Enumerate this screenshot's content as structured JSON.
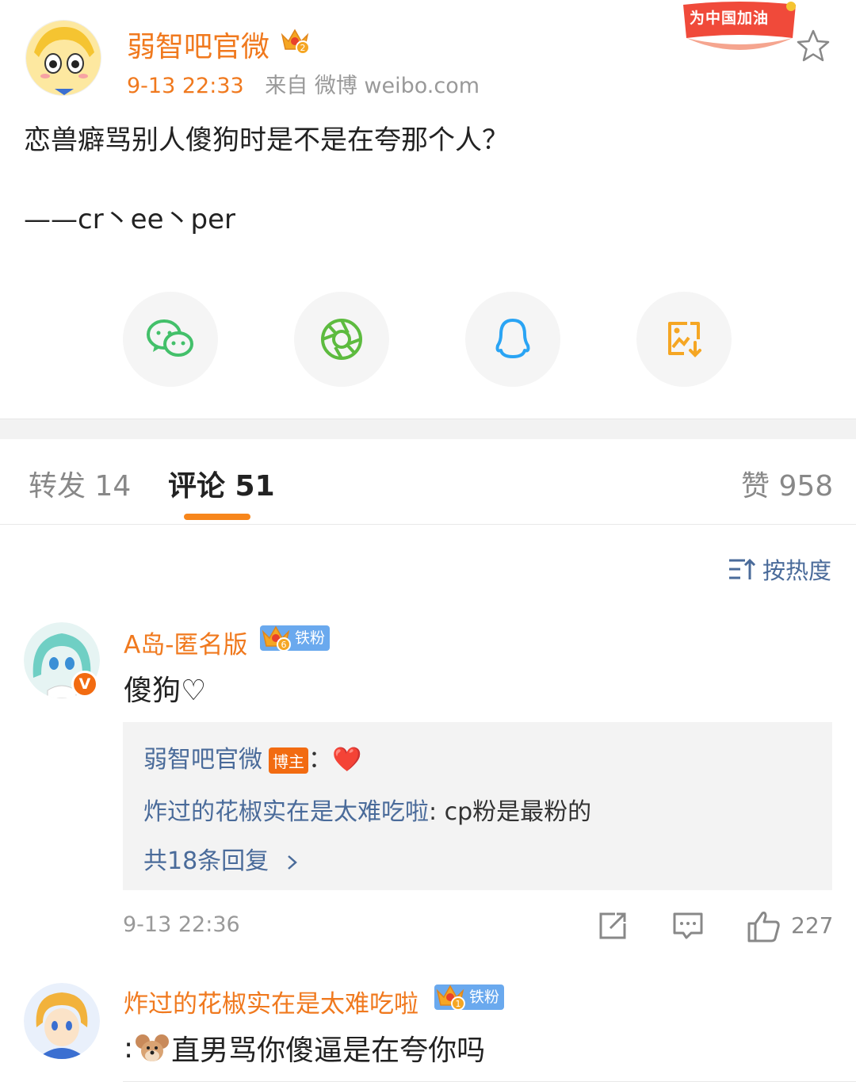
{
  "post": {
    "author": "弱智吧官微",
    "time": "9-13 22:33",
    "source": "来自 微博 weibo.com",
    "campaign_badge": "为中国加油",
    "text_line1": "恋兽癖骂别人傻狗时是不是在夸那个人？",
    "text_signature": "——cr丶ee丶per",
    "crown_level": "2"
  },
  "share": {
    "icons": [
      "wechat-icon",
      "moments-icon",
      "qq-icon",
      "save-image-icon"
    ]
  },
  "tabs": {
    "repost": "转发 14",
    "comments": "评论 51",
    "likes": "赞 958"
  },
  "sort": {
    "label": "按热度"
  },
  "comments": [
    {
      "author": "A岛-匿名版",
      "badge": "铁粉",
      "crown_level": "6",
      "verified_mark": "V",
      "text": "傻狗♡",
      "replies": {
        "line1_name": "弱智吧官微",
        "line1_tag": "博主",
        "line1_colon": "：",
        "line1_text": "❤️",
        "line2_name": "炸过的花椒实在是太难吃啦",
        "line2_text": ": cp粉是最粉的",
        "more": "共18条回复"
      },
      "time": "9-13 22:36",
      "likes": "227"
    },
    {
      "author": "炸过的花椒实在是太难吃啦",
      "badge": "铁粉",
      "crown_level": "1",
      "text_prefix": ":",
      "text": "直男骂你傻逼是在夸你吗"
    }
  ],
  "colors": {
    "accent_orange": "#f0791e",
    "link_blue": "#4a6b9a",
    "fan_badge_blue": "#6aa9ee",
    "tab_underline": "#f7861b"
  }
}
